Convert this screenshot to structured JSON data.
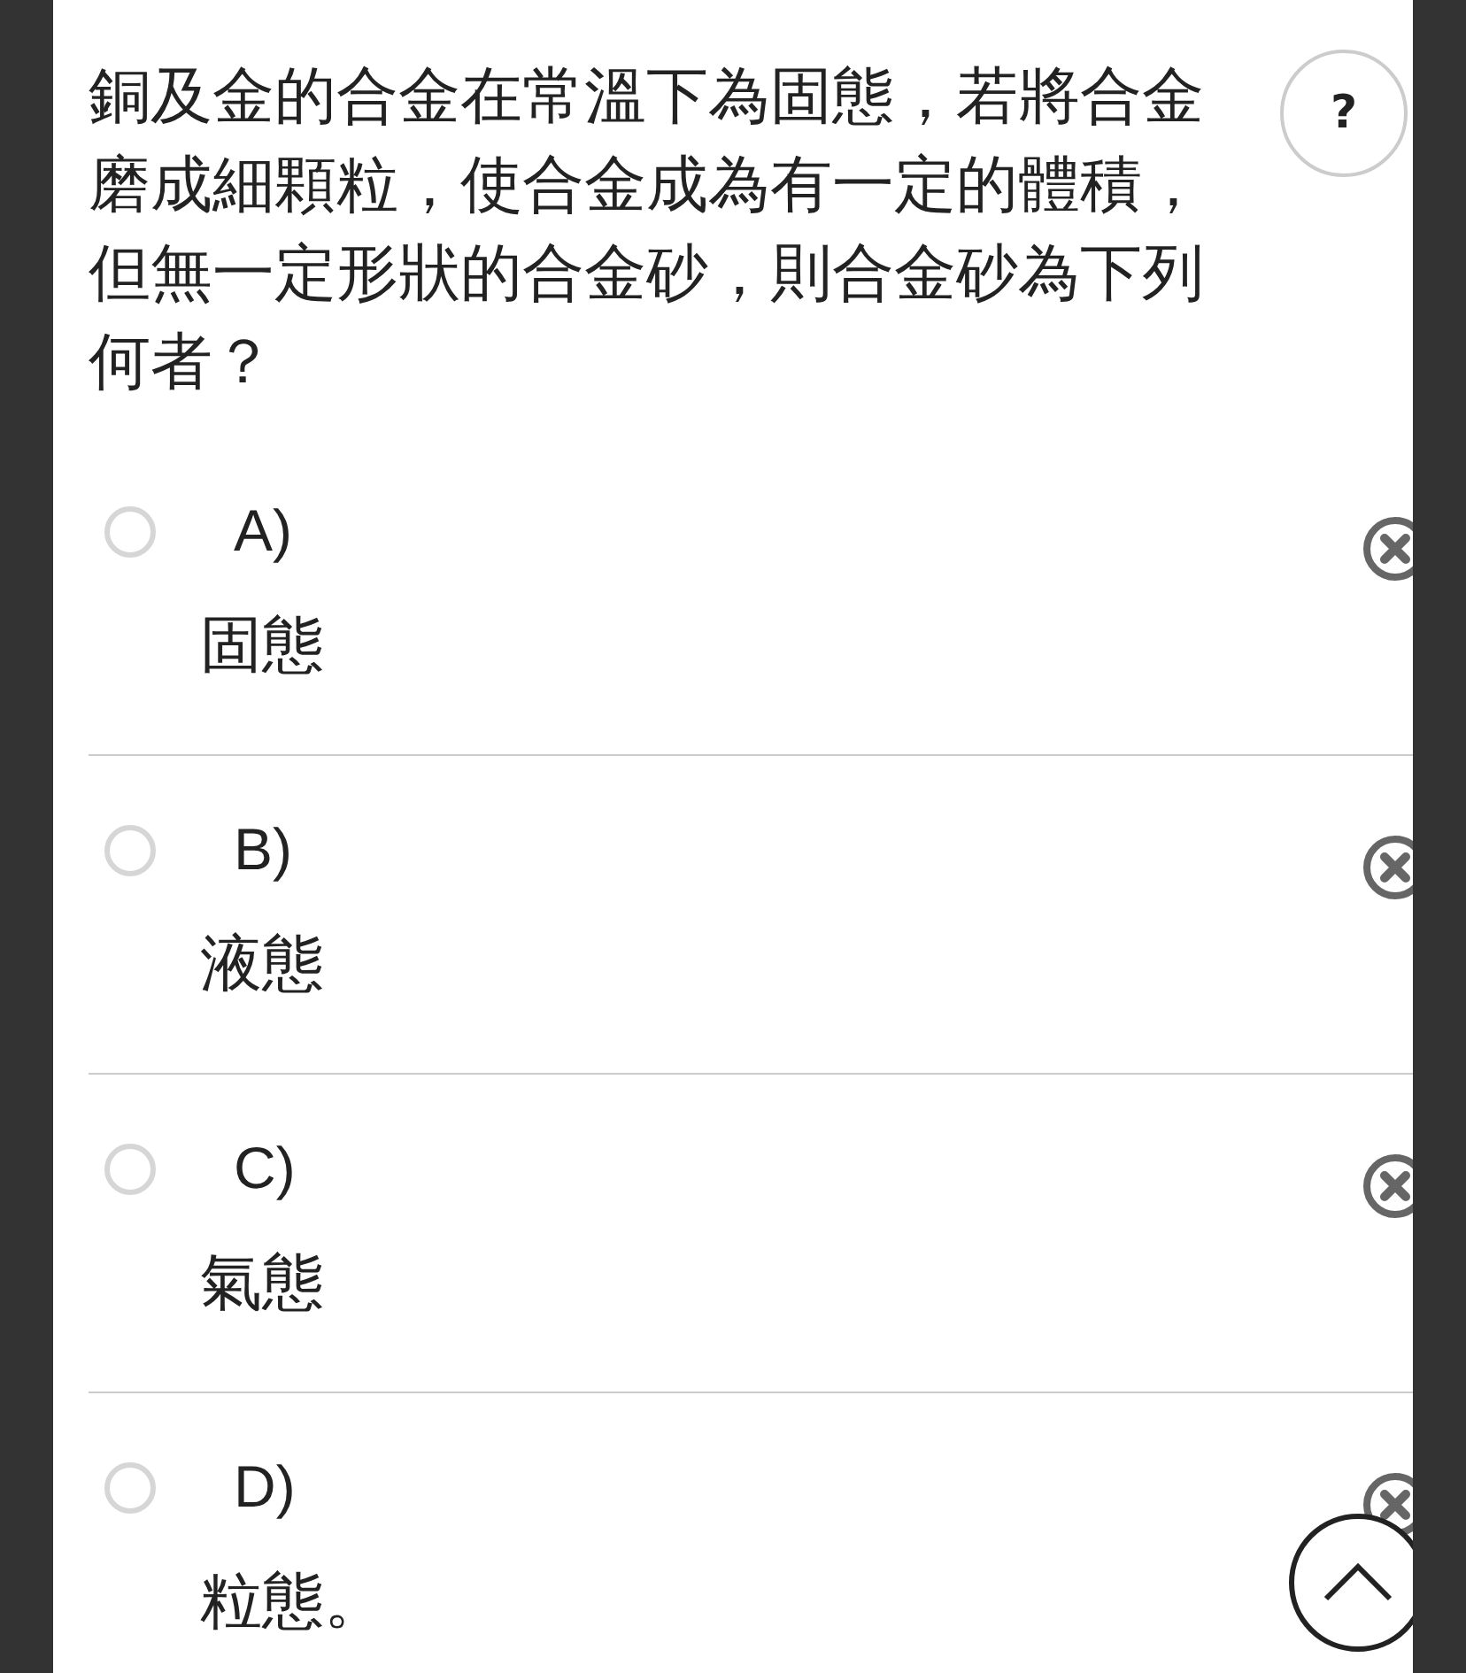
{
  "question": {
    "text": "銅及金的合金在常溫下為固態，若將合金磨成細顆粒，使合金成為有一定的體積，但無一定形狀的合金砂，則合金砂為下列何者？",
    "help_label": "?"
  },
  "options": [
    {
      "letter": "A)",
      "text": "固態",
      "selected": false
    },
    {
      "letter": "B)",
      "text": "液態",
      "selected": false
    },
    {
      "letter": "C)",
      "text": "氣態",
      "selected": false
    },
    {
      "letter": "D)",
      "text": "粒態。",
      "selected": false
    }
  ]
}
